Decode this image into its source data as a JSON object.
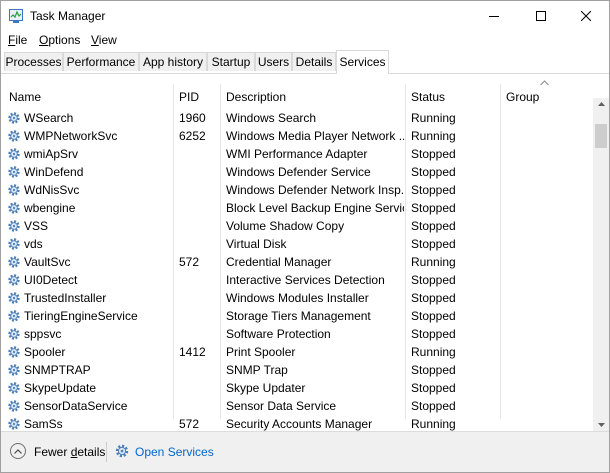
{
  "window": {
    "title": "Task Manager"
  },
  "menu": [
    {
      "label": "File",
      "access": "F",
      "rest": "ile"
    },
    {
      "label": "Options",
      "access": "O",
      "rest": "ptions"
    },
    {
      "label": "View",
      "access": "V",
      "rest": "iew"
    }
  ],
  "tabs": [
    "Processes",
    "Performance",
    "App history",
    "Startup",
    "Users",
    "Details",
    "Services"
  ],
  "active_tab": "Services",
  "columns": {
    "name": "Name",
    "pid": "PID",
    "description": "Description",
    "status": "Status",
    "group": "Group"
  },
  "rows": [
    {
      "name": "WSearch",
      "pid": "1960",
      "description": "Windows Search",
      "status": "Running"
    },
    {
      "name": "WMPNetworkSvc",
      "pid": "6252",
      "description": "Windows Media Player Network ...",
      "status": "Running"
    },
    {
      "name": "wmiApSrv",
      "pid": "",
      "description": "WMI Performance Adapter",
      "status": "Stopped"
    },
    {
      "name": "WinDefend",
      "pid": "",
      "description": "Windows Defender Service",
      "status": "Stopped"
    },
    {
      "name": "WdNisSvc",
      "pid": "",
      "description": "Windows Defender Network Insp...",
      "status": "Stopped"
    },
    {
      "name": "wbengine",
      "pid": "",
      "description": "Block Level Backup Engine Service",
      "status": "Stopped"
    },
    {
      "name": "VSS",
      "pid": "",
      "description": "Volume Shadow Copy",
      "status": "Stopped"
    },
    {
      "name": "vds",
      "pid": "",
      "description": "Virtual Disk",
      "status": "Stopped"
    },
    {
      "name": "VaultSvc",
      "pid": "572",
      "description": "Credential Manager",
      "status": "Running"
    },
    {
      "name": "UI0Detect",
      "pid": "",
      "description": "Interactive Services Detection",
      "status": "Stopped"
    },
    {
      "name": "TrustedInstaller",
      "pid": "",
      "description": "Windows Modules Installer",
      "status": "Stopped"
    },
    {
      "name": "TieringEngineService",
      "pid": "",
      "description": "Storage Tiers Management",
      "status": "Stopped"
    },
    {
      "name": "sppsvc",
      "pid": "",
      "description": "Software Protection",
      "status": "Stopped"
    },
    {
      "name": "Spooler",
      "pid": "1412",
      "description": "Print Spooler",
      "status": "Running"
    },
    {
      "name": "SNMPTRAP",
      "pid": "",
      "description": "SNMP Trap",
      "status": "Stopped"
    },
    {
      "name": "SkypeUpdate",
      "pid": "",
      "description": "Skype Updater",
      "status": "Stopped"
    },
    {
      "name": "SensorDataService",
      "pid": "",
      "description": "Sensor Data Service",
      "status": "Stopped"
    },
    {
      "name": "SamSs",
      "pid": "572",
      "description": "Security Accounts Manager",
      "status": "Running"
    }
  ],
  "footer": {
    "fewer_details": "Fewer details",
    "fewer_access": "d",
    "open_services": "Open Services"
  },
  "icons": {
    "app": "task-manager-icon",
    "service": "gear-icon",
    "fewer": "chevron-up-circle-icon",
    "open": "services-gear-icon"
  },
  "colors": {
    "link": "#0066cc",
    "gear": "#4f7fb5"
  }
}
